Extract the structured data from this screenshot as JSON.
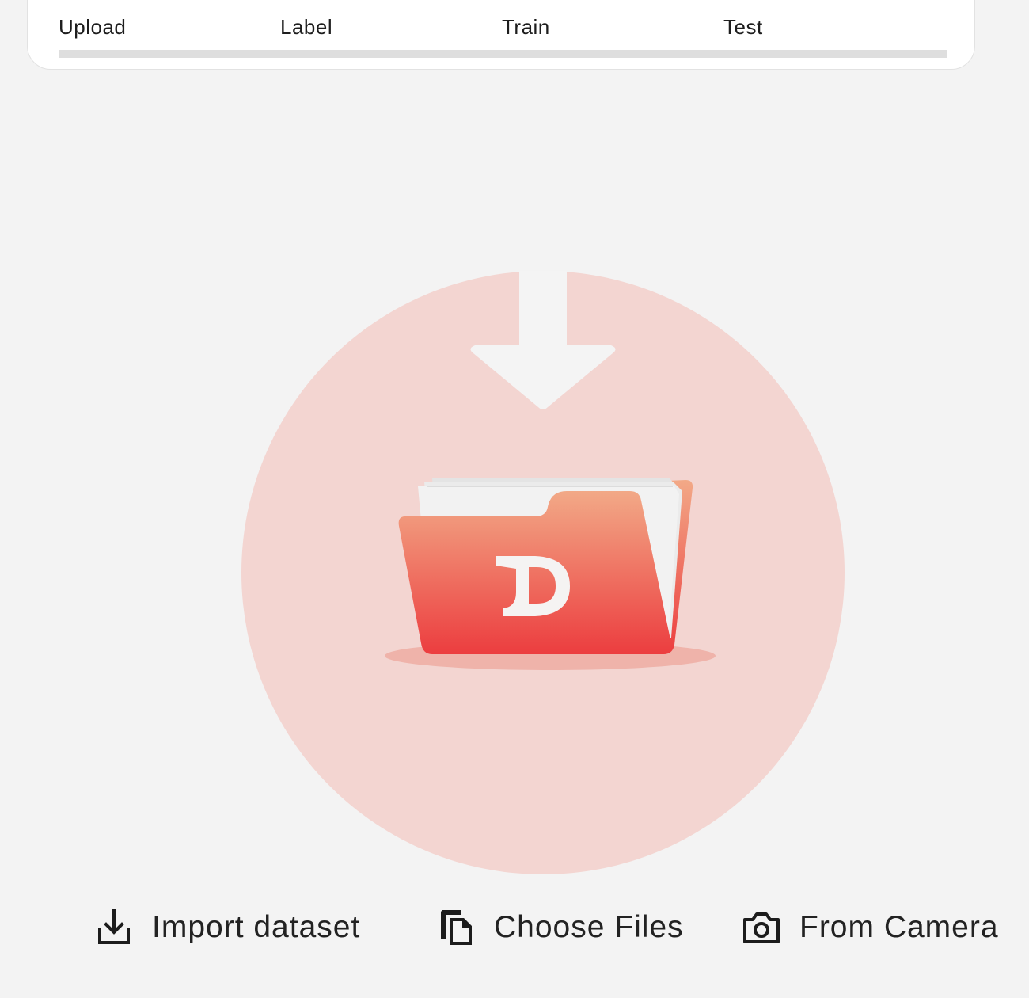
{
  "stepper": {
    "steps": [
      {
        "label": "Upload"
      },
      {
        "label": "Label"
      },
      {
        "label": "Train"
      },
      {
        "label": "Test"
      }
    ],
    "progress": 0
  },
  "illustration": {
    "folder_letter": "D",
    "colors": {
      "circle": "#f3d5d1",
      "arrow": "#f4f4f4",
      "folder_top": "#f2a987",
      "folder_bottom": "#ec3d3f",
      "shadow": "#efb3aa",
      "paper": "#f2f2f2"
    }
  },
  "actions": [
    {
      "label": "Import dataset",
      "icon": "download-tray-icon"
    },
    {
      "label": "Choose Files",
      "icon": "copy-files-icon"
    },
    {
      "label": "From Camera",
      "icon": "camera-icon"
    }
  ]
}
